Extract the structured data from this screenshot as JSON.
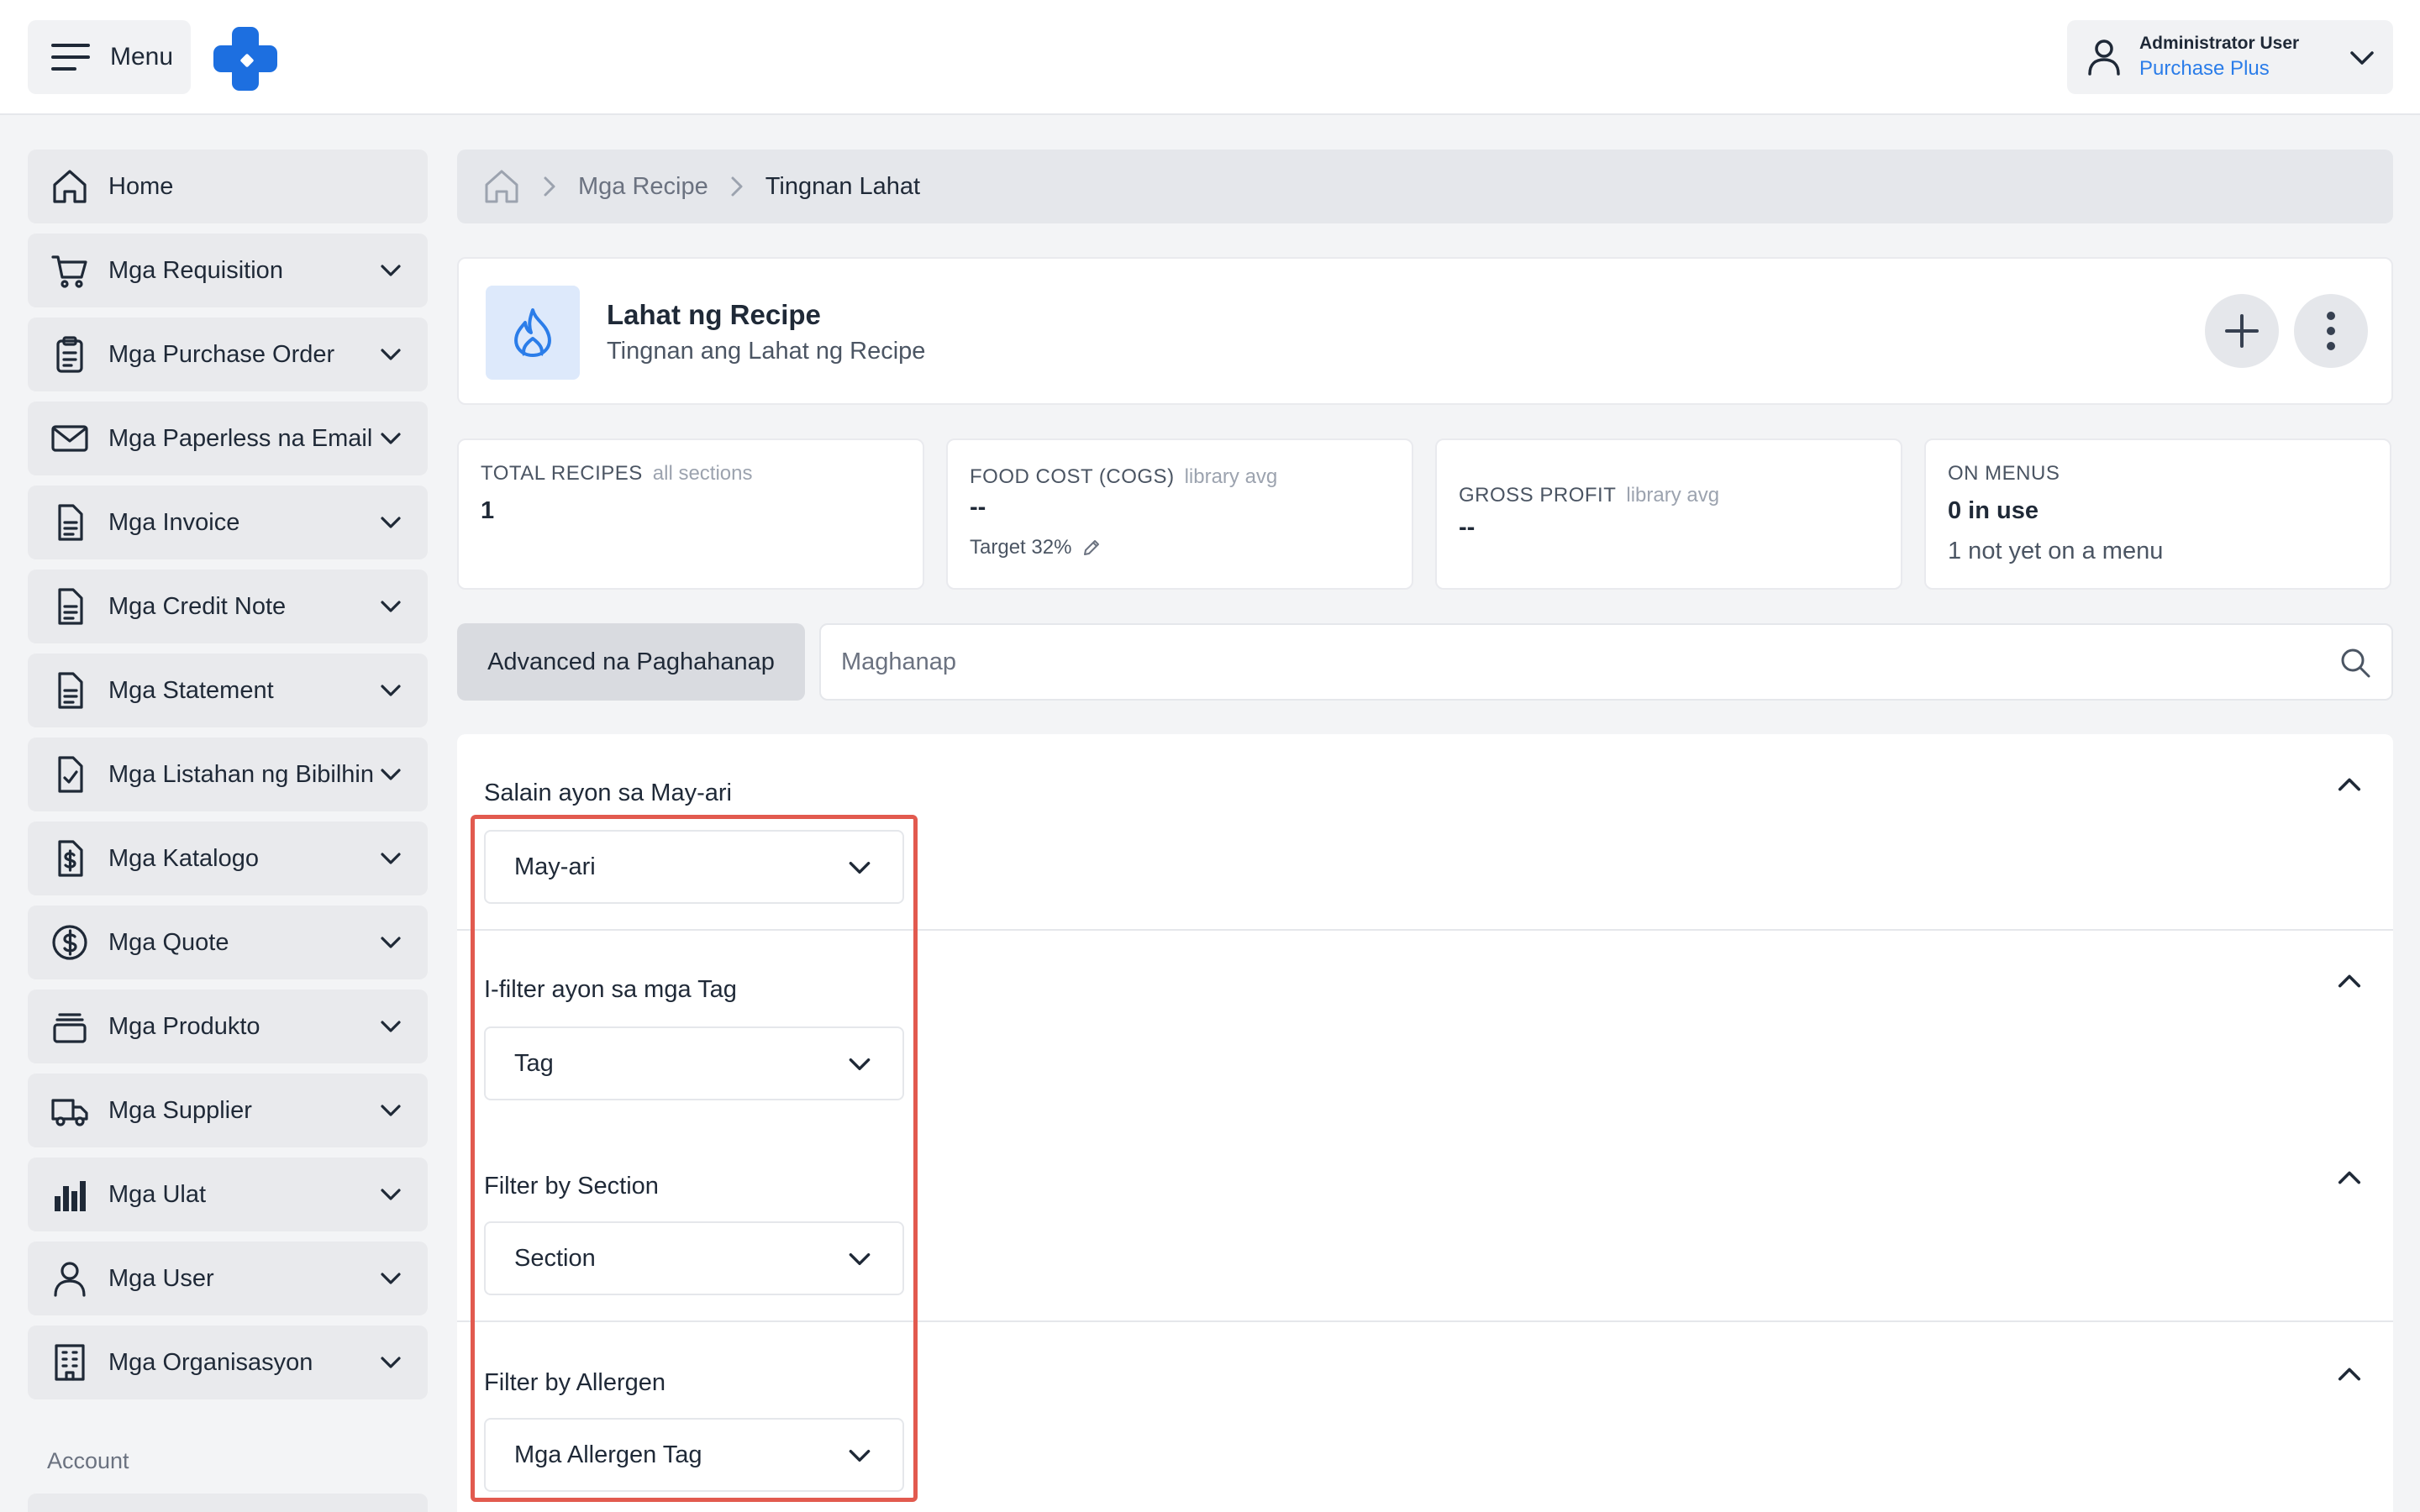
{
  "header": {
    "menu_label": "Menu",
    "user_name": "Administrator User",
    "org_name": "Purchase Plus"
  },
  "sidebar": {
    "items": [
      {
        "label": "Home",
        "icon": "home-icon",
        "has_chevron": false
      },
      {
        "label": "Mga Requisition",
        "icon": "cart-icon",
        "has_chevron": true
      },
      {
        "label": "Mga Purchase Order",
        "icon": "clipboard-icon",
        "has_chevron": true
      },
      {
        "label": "Mga Paperless na Email",
        "icon": "envelope-icon",
        "has_chevron": true
      },
      {
        "label": "Mga Invoice",
        "icon": "document-icon",
        "has_chevron": true
      },
      {
        "label": "Mga Credit Note",
        "icon": "document-icon",
        "has_chevron": true
      },
      {
        "label": "Mga Statement",
        "icon": "document-icon",
        "has_chevron": true
      },
      {
        "label": "Mga Listahan ng Bibilhin",
        "icon": "checklist-icon",
        "has_chevron": true
      },
      {
        "label": "Mga Katalogo",
        "icon": "dollar-document-icon",
        "has_chevron": true
      },
      {
        "label": "Mga Quote",
        "icon": "dollar-circle-icon",
        "has_chevron": true
      },
      {
        "label": "Mga Produkto",
        "icon": "products-icon",
        "has_chevron": true
      },
      {
        "label": "Mga Supplier",
        "icon": "truck-icon",
        "has_chevron": true
      },
      {
        "label": "Mga Ulat",
        "icon": "bar-chart-icon",
        "has_chevron": true
      },
      {
        "label": "Mga User",
        "icon": "user-icon",
        "has_chevron": true
      },
      {
        "label": "Mga Organisasyon",
        "icon": "building-icon",
        "has_chevron": true
      }
    ],
    "section_label": "Account"
  },
  "breadcrumb": {
    "items": [
      "Mga Recipe",
      "Tingnan Lahat"
    ]
  },
  "page": {
    "title": "Lahat ng Recipe",
    "subtitle": "Tingnan ang Lahat ng Recipe"
  },
  "stats": {
    "total": {
      "label": "TOTAL RECIPES",
      "qualifier": "all sections",
      "value": "1"
    },
    "food_cost": {
      "label": "FOOD COST (COGS)",
      "qualifier": "library avg",
      "value": "--",
      "note": "Target 32%"
    },
    "gross_profit": {
      "label": "GROSS PROFIT",
      "qualifier": "library avg",
      "value": "--"
    },
    "on_menus": {
      "label": "ON MENUS",
      "value": "0 in use",
      "note": "1 not yet on a menu"
    }
  },
  "search": {
    "advanced_label": "Advanced na Paghahanap",
    "placeholder": "Maghanap"
  },
  "filters": [
    {
      "title": "Salain ayon sa May-ari",
      "value": "May-ari"
    },
    {
      "title": "I-filter ayon sa mga Tag",
      "value": "Tag"
    },
    {
      "title": "Filter by Section",
      "value": "Section"
    },
    {
      "title": "Filter by Allergen",
      "value": "Mga Allergen Tag"
    }
  ],
  "colors": {
    "accent": "#2b7de9",
    "highlight": "#e25a4f"
  }
}
